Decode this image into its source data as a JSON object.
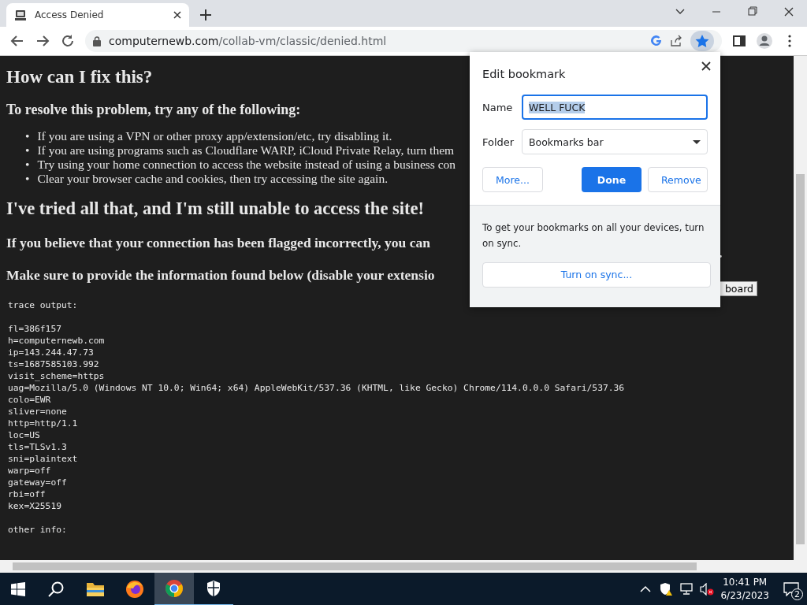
{
  "browser": {
    "tab": {
      "title": "Access Denied"
    },
    "address": {
      "host": "computernewb.com",
      "path": "/collab-vm/classic/denied.html"
    },
    "bookmarked": true
  },
  "page": {
    "heading": "How can I fix this?",
    "subheading": "To resolve this problem, try any of the following:",
    "bullet_marker": "•",
    "bullets": [
      "If you are using a VPN or other proxy app/extension/etc, try disabling it.",
      "If you are using programs such as Cloudflare WARP, iCloud Private Relay, turn them",
      "Try using your home connection to access the website instead of using a business con",
      "Clear your browser cache and cookies, then try accessing the site again."
    ],
    "heading_2": "I've tried all that, and I'm still unable to access the site!",
    "paragraphs": [
      "If you believe that your connection has been flagged incorrectly, you can",
      "Make sure to provide the information found below (disable your extensio"
    ],
    "trailing_period": ".",
    "copy_button": "board",
    "trace_title": "trace output:",
    "trace_lines": [
      "fl=386f157",
      "h=computernewb.com",
      "ip=143.244.47.73",
      "ts=1687585103.992",
      "visit_scheme=https",
      "uag=Mozilla/5.0 (Windows NT 10.0; Win64; x64) AppleWebKit/537.36 (KHTML, like Gecko) Chrome/114.0.0.0 Safari/537.36",
      "colo=EWR",
      "sliver=none",
      "http=http/1.1",
      "loc=US",
      "tls=TLSv1.3",
      "sni=plaintext",
      "warp=off",
      "gateway=off",
      "rbi=off",
      "kex=X25519"
    ],
    "other_info": "other info:"
  },
  "bookmark_dialog": {
    "title": "Edit bookmark",
    "name_label": "Name",
    "name_value": "WELL FUCK",
    "folder_label": "Folder",
    "folder_value": "Bookmarks bar",
    "buttons": [
      {
        "label": "More...",
        "kind": "secondary"
      },
      {
        "label": "Done",
        "kind": "primary"
      },
      {
        "label": "Remove",
        "kind": "secondary"
      }
    ],
    "sync_text": "To get your bookmarks on all your devices, turn on sync.",
    "sync_button": "Turn on sync..."
  },
  "taskbar": {
    "apps": [
      {
        "kind": "search",
        "active": false,
        "running": false
      },
      {
        "kind": "folder",
        "active": false,
        "running": false
      },
      {
        "kind": "firefox",
        "active": false,
        "running": false
      },
      {
        "kind": "chrome",
        "active": true,
        "running": true
      },
      {
        "kind": "shield",
        "active": false,
        "running": true
      }
    ],
    "time": "10:41 PM",
    "date": "6/23/2023",
    "notifications": "2"
  }
}
